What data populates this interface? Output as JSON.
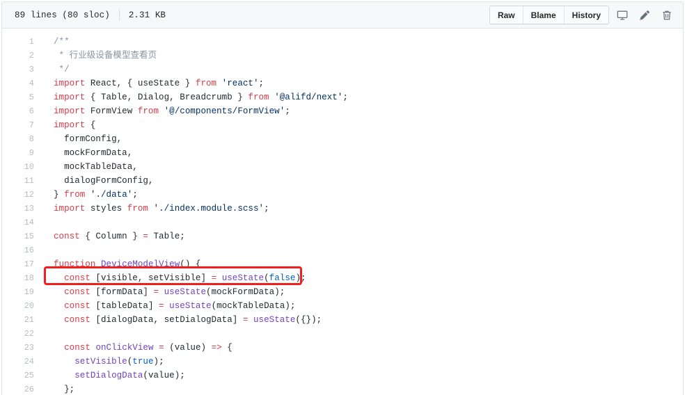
{
  "header": {
    "lines_info": "89 lines (80 sloc)",
    "file_size": "2.31 KB",
    "buttons": [
      {
        "label": "Raw",
        "name": "raw-button"
      },
      {
        "label": "Blame",
        "name": "blame-button"
      },
      {
        "label": "History",
        "name": "history-button"
      }
    ],
    "icons": [
      {
        "name": "monitor-icon",
        "title": "Open in desktop"
      },
      {
        "name": "pencil-icon",
        "title": "Edit this file"
      },
      {
        "name": "trash-icon",
        "title": "Delete this file"
      }
    ]
  },
  "code": {
    "lines": [
      {
        "n": "1",
        "tokens": [
          {
            "t": "/**",
            "c": "tok-comment"
          }
        ]
      },
      {
        "n": "2",
        "tokens": [
          {
            "t": " * 行业级设备模型查看页",
            "c": "tok-comment"
          }
        ]
      },
      {
        "n": "3",
        "tokens": [
          {
            "t": " */",
            "c": "tok-comment"
          }
        ]
      },
      {
        "n": "4",
        "tokens": [
          {
            "t": "import",
            "c": "tok-keyword"
          },
          {
            "t": " React, { useState } ",
            "c": "tok-plain"
          },
          {
            "t": "from",
            "c": "tok-keyword"
          },
          {
            "t": " ",
            "c": "tok-plain"
          },
          {
            "t": "'react'",
            "c": "tok-string"
          },
          {
            "t": ";",
            "c": "tok-plain"
          }
        ]
      },
      {
        "n": "5",
        "tokens": [
          {
            "t": "import",
            "c": "tok-keyword"
          },
          {
            "t": " { Table, Dialog, Breadcrumb } ",
            "c": "tok-plain"
          },
          {
            "t": "from",
            "c": "tok-keyword"
          },
          {
            "t": " ",
            "c": "tok-plain"
          },
          {
            "t": "'@alifd/next'",
            "c": "tok-string"
          },
          {
            "t": ";",
            "c": "tok-plain"
          }
        ]
      },
      {
        "n": "6",
        "tokens": [
          {
            "t": "import",
            "c": "tok-keyword"
          },
          {
            "t": " FormView ",
            "c": "tok-plain"
          },
          {
            "t": "from",
            "c": "tok-keyword"
          },
          {
            "t": " ",
            "c": "tok-plain"
          },
          {
            "t": "'@/components/FormView'",
            "c": "tok-string"
          },
          {
            "t": ";",
            "c": "tok-plain"
          }
        ]
      },
      {
        "n": "7",
        "tokens": [
          {
            "t": "import",
            "c": "tok-keyword"
          },
          {
            "t": " {",
            "c": "tok-plain"
          }
        ]
      },
      {
        "n": "8",
        "tokens": [
          {
            "t": "  formConfig,",
            "c": "tok-plain"
          }
        ]
      },
      {
        "n": "9",
        "tokens": [
          {
            "t": "  mockFormData,",
            "c": "tok-plain"
          }
        ]
      },
      {
        "n": "10",
        "tokens": [
          {
            "t": "  mockTableData,",
            "c": "tok-plain"
          }
        ]
      },
      {
        "n": "11",
        "tokens": [
          {
            "t": "  dialogFormConfig,",
            "c": "tok-plain"
          }
        ]
      },
      {
        "n": "12",
        "tokens": [
          {
            "t": "} ",
            "c": "tok-plain"
          },
          {
            "t": "from",
            "c": "tok-keyword"
          },
          {
            "t": " ",
            "c": "tok-plain"
          },
          {
            "t": "'./data'",
            "c": "tok-string"
          },
          {
            "t": ";",
            "c": "tok-plain"
          }
        ]
      },
      {
        "n": "13",
        "tokens": [
          {
            "t": "import",
            "c": "tok-keyword"
          },
          {
            "t": " styles ",
            "c": "tok-plain"
          },
          {
            "t": "from",
            "c": "tok-keyword"
          },
          {
            "t": " ",
            "c": "tok-plain"
          },
          {
            "t": "'./index.module.scss'",
            "c": "tok-string"
          },
          {
            "t": ";",
            "c": "tok-plain"
          }
        ]
      },
      {
        "n": "14",
        "tokens": [
          {
            "t": "",
            "c": "tok-plain"
          }
        ]
      },
      {
        "n": "15",
        "tokens": [
          {
            "t": "const",
            "c": "tok-keyword"
          },
          {
            "t": " { Column } ",
            "c": "tok-plain"
          },
          {
            "t": "=",
            "c": "tok-op"
          },
          {
            "t": " Table;",
            "c": "tok-plain"
          }
        ]
      },
      {
        "n": "16",
        "tokens": [
          {
            "t": "",
            "c": "tok-plain"
          }
        ]
      },
      {
        "n": "17",
        "tokens": [
          {
            "t": "function",
            "c": "tok-keyword"
          },
          {
            "t": " ",
            "c": "tok-plain"
          },
          {
            "t": "DeviceModelView",
            "c": "tok-fn"
          },
          {
            "t": "() {",
            "c": "tok-plain"
          }
        ]
      },
      {
        "n": "18",
        "tokens": [
          {
            "t": "  ",
            "c": "tok-plain"
          },
          {
            "t": "const",
            "c": "tok-keyword"
          },
          {
            "t": " [visible, setVisible] ",
            "c": "tok-plain"
          },
          {
            "t": "=",
            "c": "tok-op"
          },
          {
            "t": " ",
            "c": "tok-plain"
          },
          {
            "t": "useState",
            "c": "tok-fn"
          },
          {
            "t": "(",
            "c": "tok-plain"
          },
          {
            "t": "false",
            "c": "tok-const"
          },
          {
            "t": ");",
            "c": "tok-plain"
          }
        ]
      },
      {
        "n": "19",
        "tokens": [
          {
            "t": "  ",
            "c": "tok-plain"
          },
          {
            "t": "const",
            "c": "tok-keyword"
          },
          {
            "t": " [formData] ",
            "c": "tok-plain"
          },
          {
            "t": "=",
            "c": "tok-op"
          },
          {
            "t": " ",
            "c": "tok-plain"
          },
          {
            "t": "useState",
            "c": "tok-fn"
          },
          {
            "t": "(mockFormData);",
            "c": "tok-plain"
          }
        ]
      },
      {
        "n": "20",
        "tokens": [
          {
            "t": "  ",
            "c": "tok-plain"
          },
          {
            "t": "const",
            "c": "tok-keyword"
          },
          {
            "t": " [tableData] ",
            "c": "tok-plain"
          },
          {
            "t": "=",
            "c": "tok-op"
          },
          {
            "t": " ",
            "c": "tok-plain"
          },
          {
            "t": "useState",
            "c": "tok-fn"
          },
          {
            "t": "(mockTableData);",
            "c": "tok-plain"
          }
        ]
      },
      {
        "n": "21",
        "tokens": [
          {
            "t": "  ",
            "c": "tok-plain"
          },
          {
            "t": "const",
            "c": "tok-keyword"
          },
          {
            "t": " [dialogData, setDialogData] ",
            "c": "tok-plain"
          },
          {
            "t": "=",
            "c": "tok-op"
          },
          {
            "t": " ",
            "c": "tok-plain"
          },
          {
            "t": "useState",
            "c": "tok-fn"
          },
          {
            "t": "({});",
            "c": "tok-plain"
          }
        ]
      },
      {
        "n": "22",
        "tokens": [
          {
            "t": "",
            "c": "tok-plain"
          }
        ]
      },
      {
        "n": "23",
        "tokens": [
          {
            "t": "  ",
            "c": "tok-plain"
          },
          {
            "t": "const",
            "c": "tok-keyword"
          },
          {
            "t": " ",
            "c": "tok-plain"
          },
          {
            "t": "onClickView",
            "c": "tok-fn"
          },
          {
            "t": " ",
            "c": "tok-plain"
          },
          {
            "t": "=",
            "c": "tok-op"
          },
          {
            "t": " (value) ",
            "c": "tok-plain"
          },
          {
            "t": "=>",
            "c": "tok-op"
          },
          {
            "t": " {",
            "c": "tok-plain"
          }
        ]
      },
      {
        "n": "24",
        "tokens": [
          {
            "t": "    ",
            "c": "tok-plain"
          },
          {
            "t": "setVisible",
            "c": "tok-fn"
          },
          {
            "t": "(",
            "c": "tok-plain"
          },
          {
            "t": "true",
            "c": "tok-const"
          },
          {
            "t": ");",
            "c": "tok-plain"
          }
        ]
      },
      {
        "n": "25",
        "tokens": [
          {
            "t": "    ",
            "c": "tok-plain"
          },
          {
            "t": "setDialogData",
            "c": "tok-fn"
          },
          {
            "t": "(value);",
            "c": "tok-plain"
          }
        ]
      },
      {
        "n": "26",
        "tokens": [
          {
            "t": "  };",
            "c": "tok-plain"
          }
        ]
      }
    ]
  },
  "annotation": {
    "target_line": "18",
    "color": "#f01f1f"
  }
}
